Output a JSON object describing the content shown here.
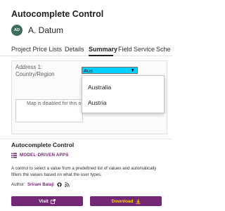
{
  "app": {
    "title": "Autocomplete Control",
    "entity_initials": "AD",
    "entity_name": "A. Datum"
  },
  "tabs": [
    {
      "label": "Project Price Lists",
      "active": false
    },
    {
      "label": "Details",
      "active": false
    },
    {
      "label": "Summary",
      "active": true
    },
    {
      "label": "Field Service",
      "active": false
    },
    {
      "label": "Sche",
      "active": false
    }
  ],
  "form": {
    "address_label_line1": "Address 1:",
    "address_label_line2": "Country/Region",
    "country_value": "Aus",
    "map_message": "Map is disabled for this o"
  },
  "dropdown": {
    "options": [
      "Australia",
      "Austria"
    ]
  },
  "component": {
    "title": "Autocomplete Control",
    "category": "MODEL-DRIVEN APPS",
    "description": "A control to select a value from a predefined list of values and automatically filters the values based on what the user types.",
    "author_label": "Author:",
    "author_name": "Sriram Balaji",
    "visit_label": "Visit",
    "download_label": "Download"
  },
  "colors": {
    "accent": "#742774",
    "select_highlight": "#00d0ff",
    "download_text": "#ffd400",
    "avatar": "#3b6e5c"
  },
  "icons": [
    "apps-grid-icon",
    "github-icon",
    "rss-icon",
    "external-link-icon",
    "download-icon",
    "chevron-down-icon"
  ]
}
